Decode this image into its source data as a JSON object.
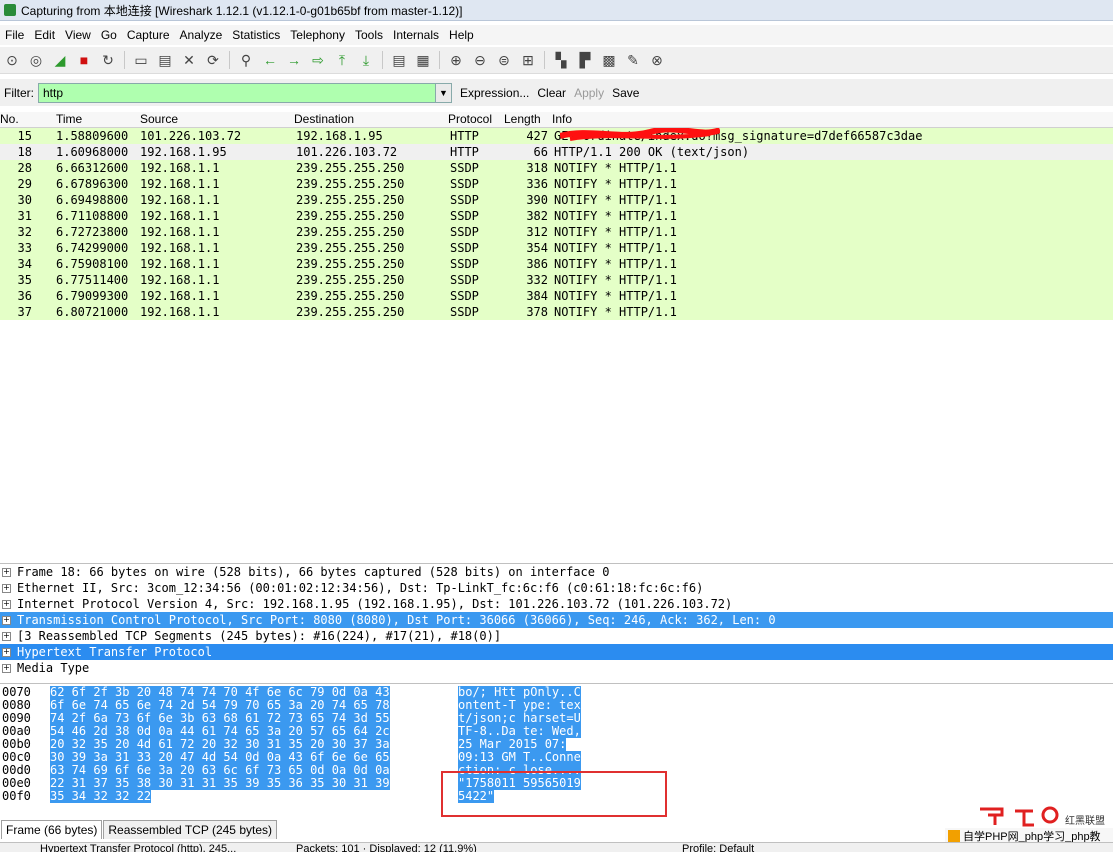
{
  "window": {
    "title": "Capturing from 本地连接   [Wireshark 1.12.1  (v1.12.1-0-g01b65bf from master-1.12)]"
  },
  "menu": [
    "File",
    "Edit",
    "View",
    "Go",
    "Capture",
    "Analyze",
    "Statistics",
    "Telephony",
    "Tools",
    "Internals",
    "Help"
  ],
  "toolbar_icons": [
    "interface-list-icon",
    "options-icon",
    "start-capture-icon",
    "stop-capture-icon",
    "restart-capture-icon",
    "open-file-icon",
    "save-file-icon",
    "close-file-icon",
    "reload-icon",
    "find-packet-icon",
    "back-icon",
    "forward-icon",
    "go-to-packet-icon",
    "first-packet-icon",
    "last-packet-icon",
    "colorize-icon",
    "auto-scroll-icon",
    "zoom-in-icon",
    "zoom-out-icon",
    "normal-size-icon",
    "resize-columns-icon",
    "capture-filters-icon",
    "display-filters-icon",
    "coloring-rules-icon",
    "preferences-icon",
    "help-icon"
  ],
  "filter": {
    "label": "Filter:",
    "value": "http",
    "expression": "Expression...",
    "clear": "Clear",
    "apply": "Apply",
    "save": "Save"
  },
  "packet_list": {
    "columns": {
      "no": "No.",
      "time": "Time",
      "source": "Source",
      "destination": "Destination",
      "protocol": "Protocol",
      "length": "Length",
      "info": "Info"
    },
    "rows": [
      {
        "no": "15",
        "time": "1.58809600",
        "source": "101.226.103.72",
        "destination": "192.168.1.95",
        "protocol": "HTTP",
        "length": "427",
        "info": "GET                    ordinate/index.do?msg_signature=d7def66587c3dae",
        "kind": "http"
      },
      {
        "no": "18",
        "time": "1.60968000",
        "source": "192.168.1.95",
        "destination": "101.226.103.72",
        "protocol": "HTTP",
        "length": "66",
        "info": "HTTP/1.1 200 OK  (text/json)",
        "kind": "selected"
      },
      {
        "no": "28",
        "time": "6.66312600",
        "source": "192.168.1.1",
        "destination": "239.255.255.250",
        "protocol": "SSDP",
        "length": "318",
        "info": "NOTIFY * HTTP/1.1",
        "kind": "ssdp"
      },
      {
        "no": "29",
        "time": "6.67896300",
        "source": "192.168.1.1",
        "destination": "239.255.255.250",
        "protocol": "SSDP",
        "length": "336",
        "info": "NOTIFY * HTTP/1.1",
        "kind": "ssdp"
      },
      {
        "no": "30",
        "time": "6.69498800",
        "source": "192.168.1.1",
        "destination": "239.255.255.250",
        "protocol": "SSDP",
        "length": "390",
        "info": "NOTIFY * HTTP/1.1",
        "kind": "ssdp"
      },
      {
        "no": "31",
        "time": "6.71108800",
        "source": "192.168.1.1",
        "destination": "239.255.255.250",
        "protocol": "SSDP",
        "length": "382",
        "info": "NOTIFY * HTTP/1.1",
        "kind": "ssdp"
      },
      {
        "no": "32",
        "time": "6.72723800",
        "source": "192.168.1.1",
        "destination": "239.255.255.250",
        "protocol": "SSDP",
        "length": "312",
        "info": "NOTIFY * HTTP/1.1",
        "kind": "ssdp"
      },
      {
        "no": "33",
        "time": "6.74299000",
        "source": "192.168.1.1",
        "destination": "239.255.255.250",
        "protocol": "SSDP",
        "length": "354",
        "info": "NOTIFY * HTTP/1.1",
        "kind": "ssdp"
      },
      {
        "no": "34",
        "time": "6.75908100",
        "source": "192.168.1.1",
        "destination": "239.255.255.250",
        "protocol": "SSDP",
        "length": "386",
        "info": "NOTIFY * HTTP/1.1",
        "kind": "ssdp"
      },
      {
        "no": "35",
        "time": "6.77511400",
        "source": "192.168.1.1",
        "destination": "239.255.255.250",
        "protocol": "SSDP",
        "length": "332",
        "info": "NOTIFY * HTTP/1.1",
        "kind": "ssdp"
      },
      {
        "no": "36",
        "time": "6.79099300",
        "source": "192.168.1.1",
        "destination": "239.255.255.250",
        "protocol": "SSDP",
        "length": "384",
        "info": "NOTIFY * HTTP/1.1",
        "kind": "ssdp"
      },
      {
        "no": "37",
        "time": "6.80721000",
        "source": "192.168.1.1",
        "destination": "239.255.255.250",
        "protocol": "SSDP",
        "length": "378",
        "info": "NOTIFY * HTTP/1.1",
        "kind": "ssdp"
      }
    ]
  },
  "details": [
    {
      "text": "Frame 18: 66 bytes on wire (528 bits), 66 bytes captured (528 bits) on interface 0",
      "hl": ""
    },
    {
      "text": "Ethernet II, Src: 3com_12:34:56 (00:01:02:12:34:56), Dst: Tp-LinkT_fc:6c:f6 (c0:61:18:fc:6c:f6)",
      "hl": ""
    },
    {
      "text": "Internet Protocol Version 4, Src: 192.168.1.95 (192.168.1.95), Dst: 101.226.103.72 (101.226.103.72)",
      "hl": ""
    },
    {
      "text": "Transmission Control Protocol, Src Port: 8080 (8080), Dst Port: 36066 (36066), Seq: 246, Ack: 362, Len: 0",
      "hl": "hl"
    },
    {
      "text": "[3 Reassembled TCP Segments (245 bytes): #16(224), #17(21), #18(0)]",
      "hl": ""
    },
    {
      "text": "Hypertext Transfer Protocol",
      "hl": "hl2"
    },
    {
      "text": "Media Type",
      "hl": ""
    }
  ],
  "bytes": [
    {
      "off": "0070",
      "hex": "62 6f 2f 3b 20 48 74 74  70 4f 6e 6c 79 0d 0a 43",
      "asc": "bo/; Htt pOnly..C"
    },
    {
      "off": "0080",
      "hex": "6f 6e 74 65 6e 74 2d 54  79 70 65 3a 20 74 65 78",
      "asc": "ontent-T ype: tex"
    },
    {
      "off": "0090",
      "hex": "74 2f 6a 73 6f 6e 3b 63  68 61 72 73 65 74 3d 55",
      "asc": "t/json;c harset=U"
    },
    {
      "off": "00a0",
      "hex": "54 46 2d 38 0d 0a 44 61  74 65 3a 20 57 65 64 2c",
      "asc": "TF-8..Da te: Wed,"
    },
    {
      "off": "00b0",
      "hex": "20 32 35 20 4d 61 72 20  32 30 31 35 20 30 37 3a",
      "asc": " 25 Mar  2015 07:"
    },
    {
      "off": "00c0",
      "hex": "30 39 3a 31 33 20 47 4d  54 0d 0a 43 6f 6e 6e 65",
      "asc": "09:13 GM T..Conne"
    },
    {
      "off": "00d0",
      "hex": "63 74 69 6f 6e 3a 20 63  6c 6f 73 65 0d 0a 0d 0a",
      "asc": "ction: c lose...."
    },
    {
      "off": "00e0",
      "hex": "22 31 37 35 38 30 31 31  35 39 35 36 35 30 31 39",
      "asc": "\"1758011 59565019"
    },
    {
      "off": "00f0",
      "hex": "35 34 32 32 22",
      "asc": "5422\""
    }
  ],
  "byte_tabs": [
    "Frame (66 bytes)",
    "Reassembled TCP (245 bytes)"
  ],
  "status": {
    "left": "Hypertext Transfer Protocol (http), 245...",
    "middle": "Packets: 101 · Displayed: 12 (11.9%)",
    "right": "Profile: Default"
  },
  "watermark": {
    "brand": "红黑联盟",
    "strip": "自学PHP网_php学习_php教"
  }
}
